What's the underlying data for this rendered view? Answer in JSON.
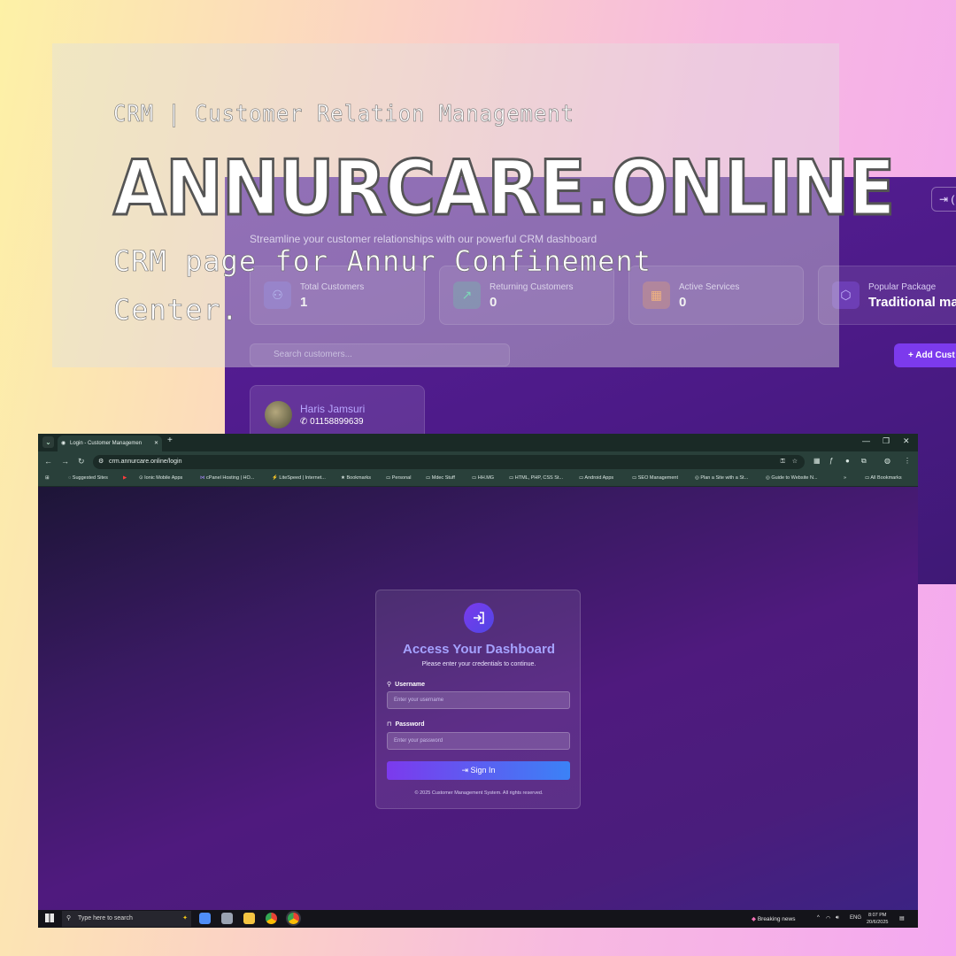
{
  "overlay": {
    "subtitle": "CRM | Customer Relation Management",
    "headline": "ANNURCARE.ONLINE",
    "description_line1": "CRM page for Annur Confinement",
    "description_line2": "Center."
  },
  "dashboard": {
    "logout_icon": "logout-icon",
    "subtitle": "Streamline your customer relationships with our powerful CRM dashboard",
    "stats": [
      {
        "label": "Total Customers",
        "value": "1",
        "icon": "users-icon",
        "color": "#6366f1"
      },
      {
        "label": "Returning Customers",
        "value": "0",
        "icon": "trending-up-icon",
        "color": "#10b981"
      },
      {
        "label": "Active Services",
        "value": "0",
        "icon": "calendar-icon",
        "color": "#f97316"
      },
      {
        "label": "Popular Package",
        "value": "Traditional massa",
        "icon": "package-icon",
        "color": "#8b5cf6"
      }
    ],
    "search_placeholder": "Search customers...",
    "add_button": "Add Cust",
    "customer": {
      "name": "Haris Jamsuri",
      "phone": "01158899639"
    }
  },
  "browser": {
    "tab_title": "Login - Customer Managemen",
    "url": "crm.annurcare.online/login",
    "bookmarks": [
      "Suggested Sites",
      "Ionic Mobile Apps",
      "cPanel Hosting | HO...",
      "LiteSpeed | Internet...",
      "Bookmarks",
      "Personal",
      "Mdec Stuff",
      "HH.MG",
      "HTML, PHP, CSS St...",
      "Android Apps",
      "SEO Management",
      "Plan a Site with a St...",
      "Guide to Website N..."
    ],
    "bookmarks_overflow": "»",
    "all_bookmarks": "All Bookmarks"
  },
  "login": {
    "title": "Access Your Dashboard",
    "subtitle": "Please enter your credentials to continue.",
    "username_label": "Username",
    "username_placeholder": "Enter your username",
    "password_label": "Password",
    "password_placeholder": "Enter your password",
    "signin_label": "Sign In",
    "footer": "© 2025 Customer Management System. All rights reserved."
  },
  "taskbar": {
    "search_placeholder": "Type here to search",
    "news": "Breaking news",
    "language": "ENG",
    "time": "8:07 PM",
    "date": "20/6/2025"
  },
  "colors": {
    "accent": "#7c3aed",
    "heading": "#a5a2ff"
  }
}
